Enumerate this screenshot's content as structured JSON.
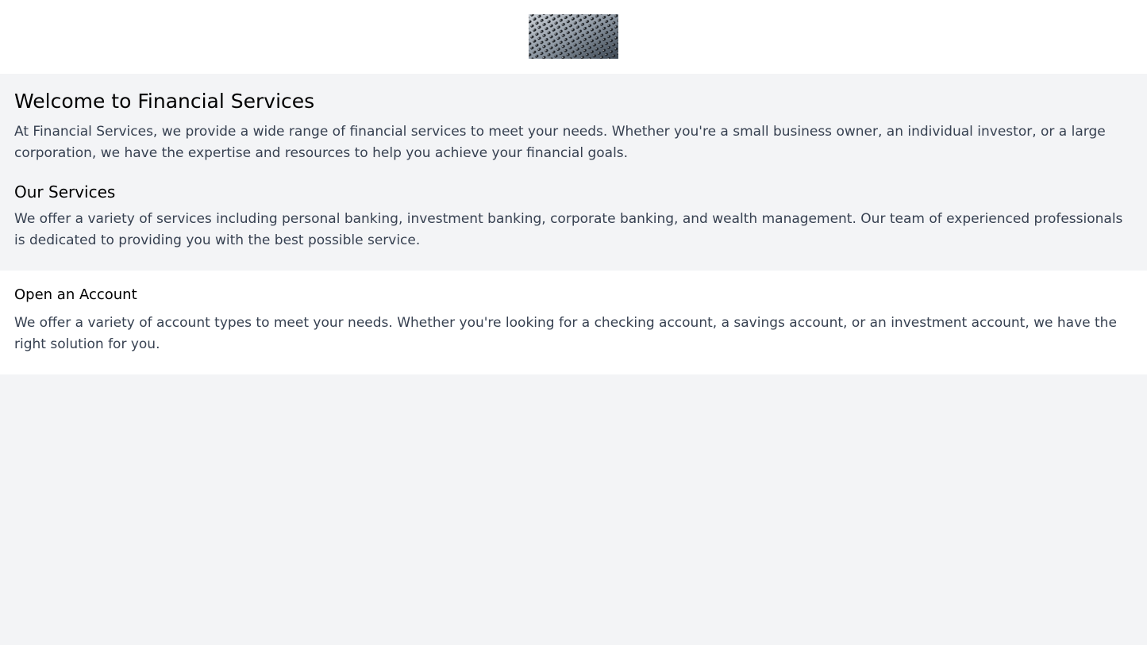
{
  "header": {
    "logo_icon": "metallic-hexagon-pattern-logo"
  },
  "welcome": {
    "title": "Welcome to Financial Services",
    "intro": "At Financial Services, we provide a wide range of financial services to meet your needs. Whether you're a small business owner, an individual investor, or a large corporation, we have the expertise and resources to help you achieve your financial goals."
  },
  "services": {
    "title": "Our Services",
    "text": "We offer a variety of services including personal banking, investment banking, corporate banking, and wealth management. Our team of experienced professionals is dedicated to providing you with the best possible service."
  },
  "account": {
    "title": "Open an Account",
    "text": "We offer a variety of account types to meet your needs. Whether you're looking for a checking account, a savings account, or an investment account, we have the right solution for you."
  },
  "colors": {
    "page_background": "#f3f4f6",
    "header_background": "#ffffff",
    "body_text": "#374151",
    "heading_text": "#000000"
  }
}
